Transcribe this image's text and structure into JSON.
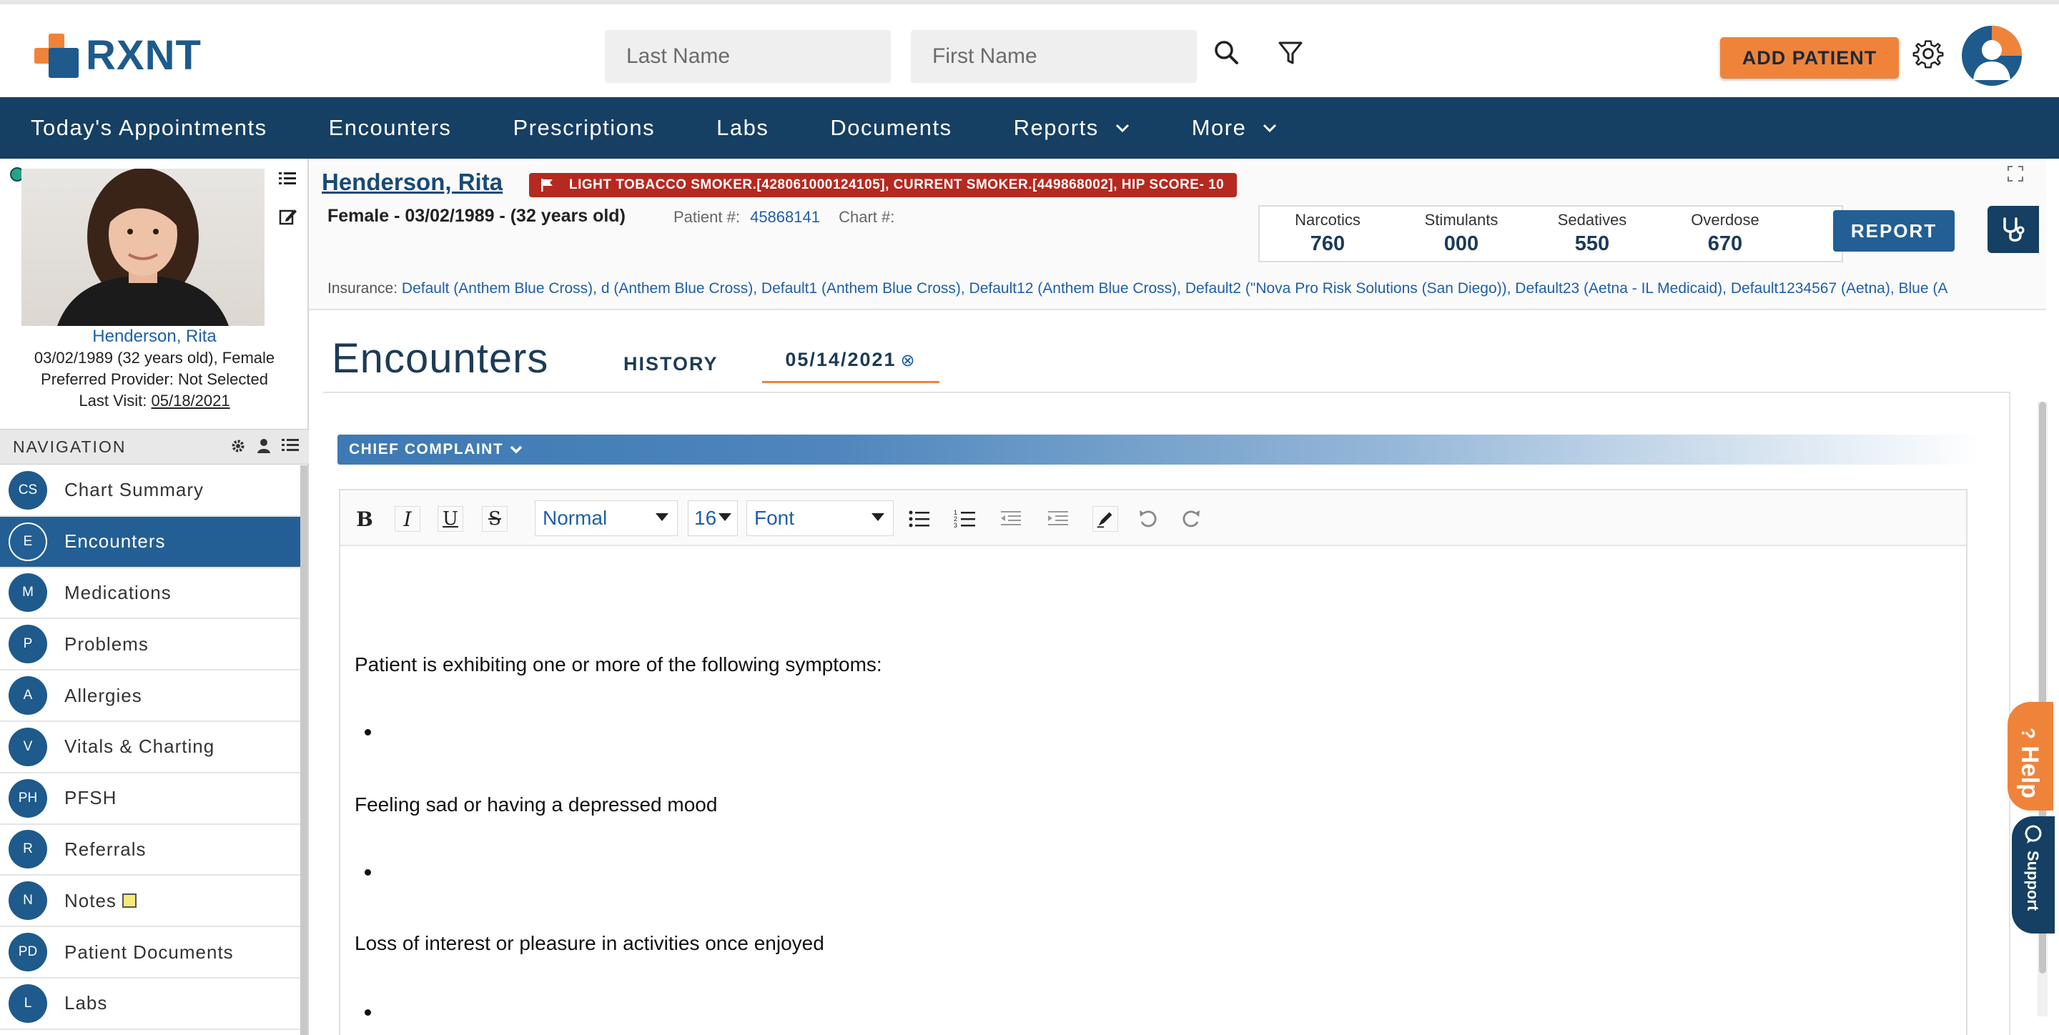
{
  "header": {
    "logo_text": "RXNT",
    "last_name_placeholder": "Last Name",
    "first_name_placeholder": "First Name",
    "add_patient_label": "ADD PATIENT"
  },
  "topnav": {
    "items": [
      {
        "label": "Today's Appointments"
      },
      {
        "label": "Encounters"
      },
      {
        "label": "Prescriptions"
      },
      {
        "label": "Labs"
      },
      {
        "label": "Documents"
      },
      {
        "label": "Reports"
      },
      {
        "label": "More"
      }
    ]
  },
  "patient_card": {
    "name": "Henderson, Rita",
    "dob_line": "03/02/1989 (32 years old), Female",
    "provider_line": "Preferred Provider: Not Selected",
    "last_visit_label": "Last Visit:",
    "last_visit_value": "05/18/2021"
  },
  "navigation": {
    "title": "NAVIGATION",
    "items": [
      {
        "badge": "CS",
        "label": "Chart Summary"
      },
      {
        "badge": "E",
        "label": "Encounters"
      },
      {
        "badge": "M",
        "label": "Medications"
      },
      {
        "badge": "P",
        "label": "Problems"
      },
      {
        "badge": "A",
        "label": "Allergies"
      },
      {
        "badge": "V",
        "label": "Vitals & Charting"
      },
      {
        "badge": "PH",
        "label": "PFSH"
      },
      {
        "badge": "R",
        "label": "Referrals"
      },
      {
        "badge": "N",
        "label": "Notes"
      },
      {
        "badge": "PD",
        "label": "Patient Documents"
      },
      {
        "badge": "L",
        "label": "Labs"
      }
    ],
    "active_label": "Encounters"
  },
  "patient_header": {
    "name": "Henderson, Rita",
    "alert": "LIGHT TOBACCO SMOKER.[428061000124105], CURRENT SMOKER.[449868002], HIP SCORE- 10",
    "sub": "Female - 03/02/1989 - (32 years old)",
    "patient_num_label": "Patient #:",
    "patient_num": "45868141",
    "chart_num_label": "Chart #:",
    "pdmp": [
      {
        "label": "Narcotics",
        "value": "760"
      },
      {
        "label": "Stimulants",
        "value": "000"
      },
      {
        "label": "Sedatives",
        "value": "550"
      },
      {
        "label": "Overdose",
        "value": "670"
      }
    ],
    "report_label": "REPORT",
    "insurance_label": "Insurance:",
    "insurance_value": "Default (Anthem Blue Cross), d (Anthem Blue Cross), Default1 (Anthem Blue Cross), Default12 (Anthem Blue Cross), Default2 (\"Nova Pro Risk Solutions (San Diego)), Default23 (Aetna - IL Medicaid), Default1234567 (Aetna), Blue (A"
  },
  "encounters": {
    "title": "Encounters",
    "tab_history": "HISTORY",
    "tab_date": "05/14/2021",
    "section_title": "CHIEF COMPLAINT",
    "toolbar": {
      "style_value": "Normal",
      "size_value": "16",
      "font_value": "Font"
    },
    "doc_lines": [
      "Patient is exhibiting one or more of the following symptoms:",
      "Feeling sad or having a depressed mood",
      "Loss of interest or pleasure in activities once enjoyed"
    ]
  },
  "floating": {
    "help_label": "Help",
    "support_label": "Support"
  },
  "colors": {
    "brand_navy": "#153f63",
    "brand_blue": "#1e5a8c",
    "brand_orange": "#f0833a",
    "alert_red": "#b6291f"
  }
}
